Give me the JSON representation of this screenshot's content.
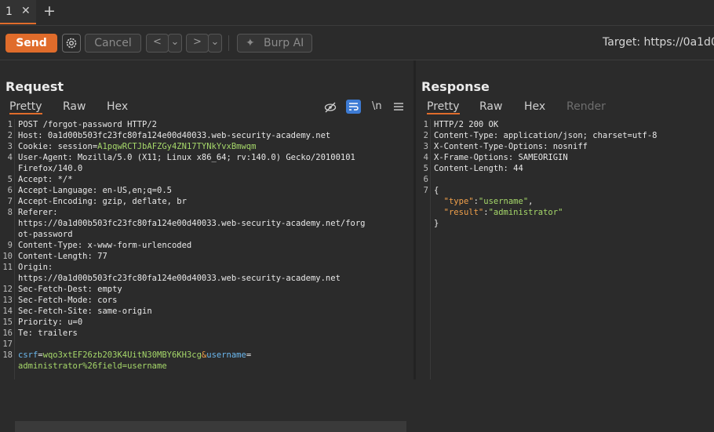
{
  "tabs": [
    {
      "label": "1",
      "close": "✕"
    }
  ],
  "add_tab": "+",
  "toolbar": {
    "send_label": "Send",
    "cancel_label": "Cancel",
    "back_label": "<",
    "forward_label": ">",
    "dropdown": "⌄",
    "burp_ai_label": "Burp AI",
    "target_label": "Target: https://0a1d0"
  },
  "request": {
    "title": "Request",
    "tabs": [
      "Pretty",
      "Raw",
      "Hex"
    ],
    "newline_toggle": "\\n",
    "lines": [
      {
        "n": "1",
        "t": "POST /forgot-password HTTP/2"
      },
      {
        "n": "2",
        "t": "Host: 0a1d00b503fc23fc80fa124e00d40033.web-security-academy.net"
      },
      {
        "n": "3",
        "k": "Cookie: session=",
        "v": "A1pqwRCTJbAFZGy4ZN17TYNkYvxBmwqm"
      },
      {
        "n": "4",
        "t": "User-Agent: Mozilla/5.0 (X11; Linux x86_64; rv:140.0) Gecko/20100101"
      },
      {
        "n": "",
        "t": "Firefox/140.0"
      },
      {
        "n": "5",
        "t": "Accept: */*"
      },
      {
        "n": "6",
        "t": "Accept-Language: en-US,en;q=0.5"
      },
      {
        "n": "7",
        "t": "Accept-Encoding: gzip, deflate, br"
      },
      {
        "n": "8",
        "t": "Referer:"
      },
      {
        "n": "",
        "t": "https://0a1d00b503fc23fc80fa124e00d40033.web-security-academy.net/forg"
      },
      {
        "n": "",
        "t": "ot-password"
      },
      {
        "n": "9",
        "t": "Content-Type: x-www-form-urlencoded"
      },
      {
        "n": "10",
        "t": "Content-Length: 77"
      },
      {
        "n": "11",
        "t": "Origin:"
      },
      {
        "n": "",
        "t": "https://0a1d00b503fc23fc80fa124e00d40033.web-security-academy.net"
      },
      {
        "n": "12",
        "t": "Sec-Fetch-Dest: empty"
      },
      {
        "n": "13",
        "t": "Sec-Fetch-Mode: cors"
      },
      {
        "n": "14",
        "t": "Sec-Fetch-Site: same-origin"
      },
      {
        "n": "15",
        "t": "Priority: u=0"
      },
      {
        "n": "16",
        "t": "Te: trailers"
      },
      {
        "n": "17",
        "t": ""
      },
      {
        "n": "18",
        "b1": "csrf",
        "e1": "=",
        "v1": "wqo3xtEF26zb203K4UitN30MBY6KH3cg",
        "amp": "&",
        "b2": "username",
        "e2": "="
      },
      {
        "n": "",
        "v3": "administrator%26field=username"
      }
    ]
  },
  "response": {
    "title": "Response",
    "tabs": [
      "Pretty",
      "Raw",
      "Hex",
      "Render"
    ],
    "lines": [
      {
        "n": "1",
        "t": "HTTP/2 200 OK"
      },
      {
        "n": "2",
        "t": "Content-Type: application/json; charset=utf-8"
      },
      {
        "n": "3",
        "t": "X-Content-Type-Options: nosniff"
      },
      {
        "n": "4",
        "t": "X-Frame-Options: SAMEORIGIN"
      },
      {
        "n": "5",
        "t": "Content-Length: 44"
      },
      {
        "n": "6",
        "t": ""
      },
      {
        "n": "7",
        "t": "{"
      },
      {
        "n": "",
        "t1": "  ",
        "k1": "\"type\"",
        "c1": ":",
        "v1": "\"username\"",
        "s1": ","
      },
      {
        "n": "",
        "t2": "  ",
        "k2": "\"result\"",
        "c2": ":",
        "v2": "\"administrator\""
      },
      {
        "n": "",
        "t": "}"
      }
    ]
  },
  "colors": {
    "accent": "#e06c2b",
    "string": "#a6d86a",
    "param": "#6cb9f0",
    "key": "#f2a14b"
  }
}
